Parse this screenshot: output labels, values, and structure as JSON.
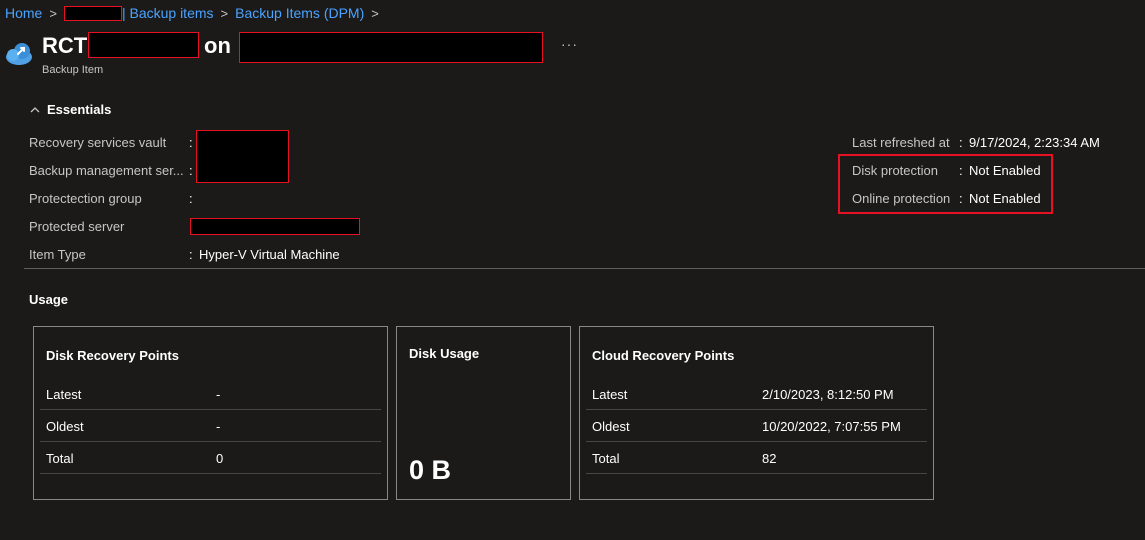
{
  "breadcrumb": {
    "home": "Home",
    "backup_items": "| Backup items",
    "backup_items_dpm": "Backup Items (DPM)"
  },
  "header": {
    "title_prefix": "RCT",
    "title_on": "on",
    "subtitle": "Backup Item",
    "more": "···"
  },
  "essentials": {
    "toggle_label": "Essentials",
    "left": [
      {
        "label": "Recovery services vault",
        "value": ""
      },
      {
        "label": "Backup management ser...",
        "value": ""
      },
      {
        "label": "Protectection group",
        "value": ""
      },
      {
        "label": "Protected server",
        "value": ""
      },
      {
        "label": "Item Type",
        "value": "Hyper-V Virtual Machine"
      }
    ],
    "right": [
      {
        "label": "Last refreshed at",
        "value": "9/17/2024, 2:23:34 AM"
      },
      {
        "label": "Disk protection",
        "value": "Not Enabled"
      },
      {
        "label": "Online protection",
        "value": "Not Enabled"
      }
    ],
    "colon": ":"
  },
  "usage": {
    "title": "Usage",
    "disk_recovery_points": {
      "title": "Disk Recovery Points",
      "rows": [
        {
          "label": "Latest",
          "value": "-"
        },
        {
          "label": "Oldest",
          "value": "-"
        },
        {
          "label": "Total",
          "value": "0"
        }
      ]
    },
    "disk_usage": {
      "title": "Disk Usage",
      "value": "0 B"
    },
    "cloud_recovery_points": {
      "title": "Cloud Recovery Points",
      "rows": [
        {
          "label": "Latest",
          "value": "2/10/2023, 8:12:50 PM"
        },
        {
          "label": "Oldest",
          "value": "10/20/2022, 7:07:55 PM"
        },
        {
          "label": "Total",
          "value": "82"
        }
      ]
    }
  },
  "colors": {
    "background": "#1b1a19",
    "link": "#4aa3ff",
    "highlight": "#e81123",
    "border": "#8a8886"
  },
  "icons": {
    "app": "backup-cloud-icon",
    "essentials_toggle": "chevron-up-icon"
  }
}
